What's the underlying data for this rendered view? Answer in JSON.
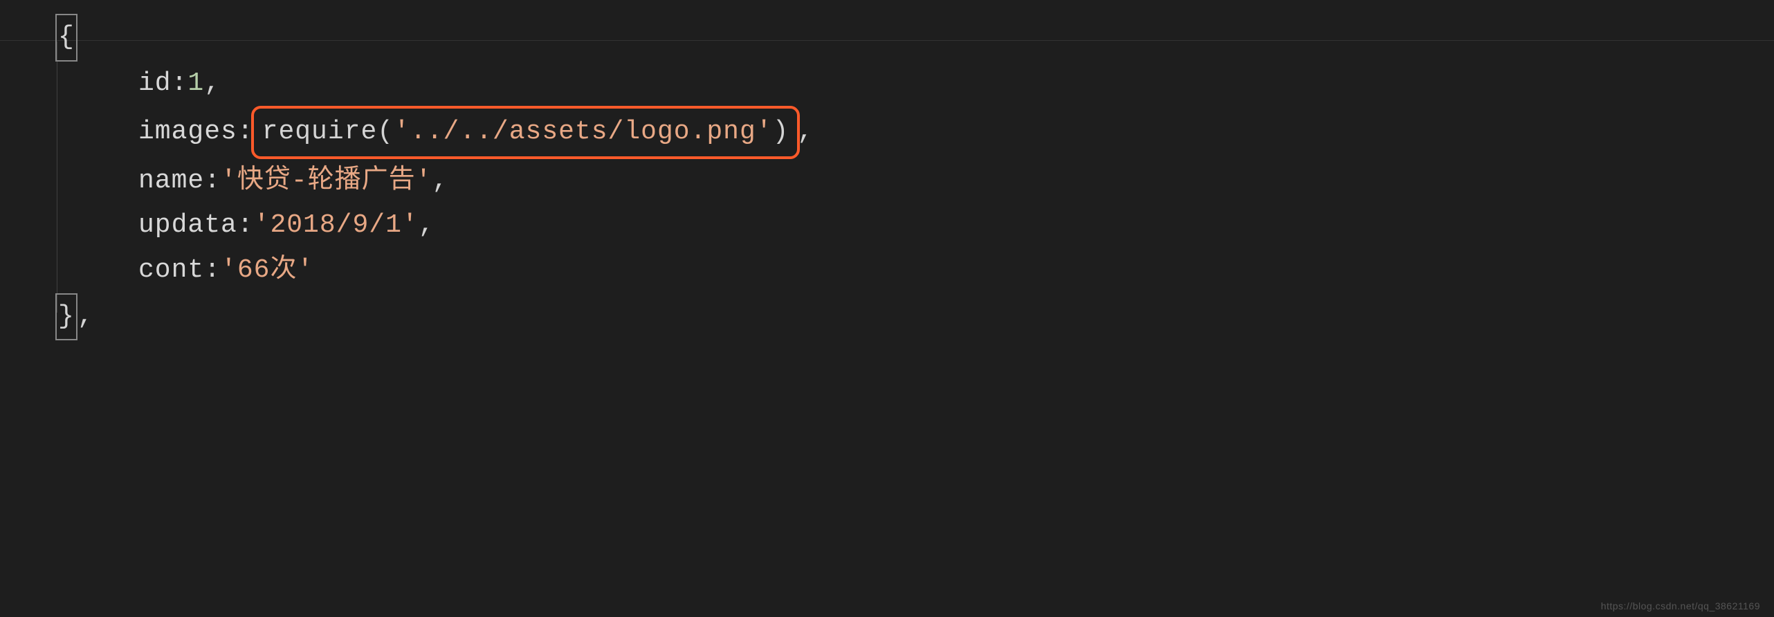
{
  "code": {
    "open_brace": "{",
    "close_brace": "}",
    "lines": {
      "id": {
        "key": "id",
        "value": "1"
      },
      "images": {
        "key": "images",
        "func": "require",
        "arg": "'../../assets/logo.png'"
      },
      "name": {
        "key": "name",
        "value": "'快贷-轮播广告'"
      },
      "updata": {
        "key": "updata",
        "value": "'2018/9/1'"
      },
      "cont": {
        "key": "cont",
        "value": "'66次'"
      }
    },
    "punctuation": {
      "colon": ":",
      "comma": ",",
      "open_paren": "(",
      "close_paren": ")"
    }
  },
  "watermark": "https://blog.csdn.net/qq_38621169"
}
